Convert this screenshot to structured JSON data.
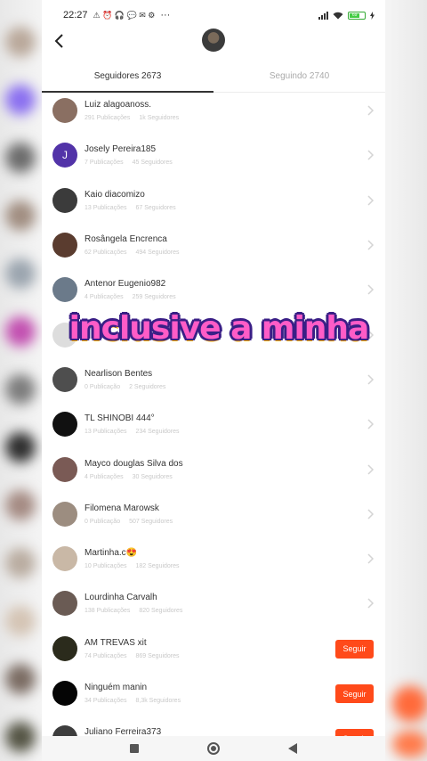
{
  "status_bar": {
    "time": "22:27",
    "indicators": "⚠ ⏰ 🎧 💬 ✉ ⚙",
    "more": "···",
    "battery": "69"
  },
  "tabs": [
    {
      "label": "Seguidores 2673",
      "active": true
    },
    {
      "label": "Seguindo 2740",
      "active": false
    }
  ],
  "stats_labels": {
    "posts": "Publicações",
    "followers": "Seguidores"
  },
  "users": [
    {
      "name": "Luiz alagoanoss.",
      "posts": "291 Publicações",
      "followers": "1k Seguidores",
      "action": "chevron",
      "avatar_color": "#8a6f62",
      "initial": ""
    },
    {
      "name": "Josely Pereira185",
      "posts": "7 Publicações",
      "followers": "45 Seguidores",
      "action": "chevron",
      "avatar_color": "#5233a8",
      "initial": "J"
    },
    {
      "name": "Kaio diacomizo",
      "posts": "13 Publicações",
      "followers": "67 Seguidores",
      "action": "chevron",
      "avatar_color": "#3b3b3b",
      "initial": ""
    },
    {
      "name": "Rosângela Encrenca",
      "posts": "62 Publicações",
      "followers": "494 Seguidores",
      "action": "chevron",
      "avatar_color": "#5a3c2f",
      "initial": ""
    },
    {
      "name": "Antenor Eugenio982",
      "posts": "4 Publicações",
      "followers": "259 Seguidores",
      "action": "chevron",
      "avatar_color": "#6b7a8a",
      "initial": ""
    },
    {
      "name": "",
      "posts": "",
      "followers": "",
      "action": "chevron",
      "avatar_color": "#dddddd",
      "initial": ""
    },
    {
      "name": "Nearlison Bentes",
      "posts": "0 Publicação",
      "followers": "2 Seguidores",
      "action": "chevron",
      "avatar_color": "#4e4e4e",
      "initial": ""
    },
    {
      "name": "TL SHINOBI 444°",
      "posts": "13 Publicações",
      "followers": "234 Seguidores",
      "action": "chevron",
      "avatar_color": "#111111",
      "initial": ""
    },
    {
      "name": "Mayco douglas Silva dos",
      "posts": "4 Publicações",
      "followers": "30 Seguidores",
      "action": "chevron",
      "avatar_color": "#7a5a55",
      "initial": ""
    },
    {
      "name": "Filomena Marowsk",
      "posts": "0 Publicação",
      "followers": "507 Seguidores",
      "action": "chevron",
      "avatar_color": "#9c8d80",
      "initial": ""
    },
    {
      "name": "Martinha.c😍",
      "posts": "10 Publicações",
      "followers": "182 Seguidores",
      "action": "chevron",
      "avatar_color": "#c9b8a6",
      "initial": ""
    },
    {
      "name": "Lourdinha Carvalh",
      "posts": "138 Publicações",
      "followers": "820 Seguidores",
      "action": "chevron",
      "avatar_color": "#6a5b54",
      "initial": ""
    },
    {
      "name": "AM TREVAS xit",
      "posts": "74 Publicações",
      "followers": "869 Seguidores",
      "action": "follow",
      "avatar_color": "#2b2b1c",
      "initial": ""
    },
    {
      "name": "Ninguém manin",
      "posts": "34 Publicações",
      "followers": "8,3k Seguidores",
      "action": "follow",
      "avatar_color": "#050505",
      "initial": ""
    },
    {
      "name": "Juliano Ferreira373",
      "posts": "",
      "followers": "",
      "action": "follow",
      "avatar_color": "#3d3d3d",
      "initial": ""
    }
  ],
  "follow_label": "Seguir",
  "overlay_caption": "inclusive a minha",
  "colors": {
    "accent": "#ff4a1a",
    "caption_fill": "#ff5cc7",
    "caption_outline": "#3a1f86"
  }
}
